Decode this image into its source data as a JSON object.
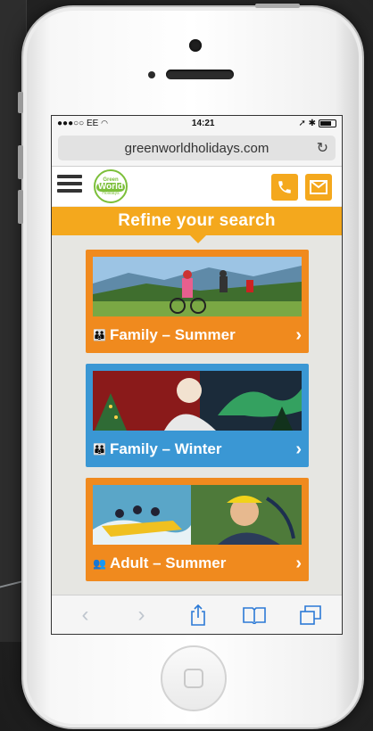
{
  "status_bar": {
    "carrier": "●●●○○ EE",
    "wifi": "wifi-icon",
    "time": "14:21",
    "right": "➚ ✱",
    "battery": "battery-icon"
  },
  "browser": {
    "url": "greenworldholidays.com",
    "reload_icon": "reload-icon"
  },
  "site": {
    "logo": {
      "line1": "Green",
      "line2": "World",
      "line3": "Holidays"
    },
    "phone_icon": "phone-icon",
    "mail_icon": "mail-icon",
    "refine_label": "Refine your search"
  },
  "cards": [
    {
      "label": "Family – Summer",
      "icon": "family-icon",
      "color": "#f08a1e"
    },
    {
      "label": "Family – Winter",
      "icon": "family-icon",
      "color": "#3a97d4"
    },
    {
      "label": "Adult – Summer",
      "icon": "adult-icon",
      "color": "#f08a1e"
    }
  ],
  "colors": {
    "accent": "#f4a81d",
    "orange": "#f08a1e",
    "blue": "#3a97d4",
    "brand_green": "#7cbf3a",
    "ios_blue": "#2c7ad6"
  },
  "toolbar": {
    "back": "‹",
    "forward": "›"
  }
}
